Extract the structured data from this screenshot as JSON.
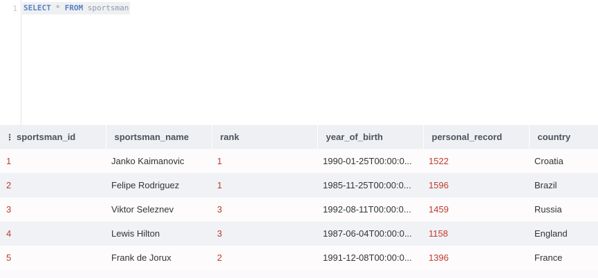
{
  "editor": {
    "line_number": "1",
    "tokens": {
      "select": "SELECT",
      "star": "*",
      "from": "FROM",
      "table": "sportsman"
    }
  },
  "result": {
    "columns": [
      "sportsman_id",
      "sportsman_name",
      "rank",
      "year_of_birth",
      "personal_record",
      "country"
    ],
    "rows": [
      {
        "sportsman_id": "1",
        "sportsman_name": "Janko Kaimanovic",
        "rank": "1",
        "year_of_birth": "1990-01-25T00:00:0...",
        "personal_record": "1522",
        "country": "Croatia"
      },
      {
        "sportsman_id": "2",
        "sportsman_name": "Felipe Rodriguez",
        "rank": "1",
        "year_of_birth": "1985-11-25T00:00:0...",
        "personal_record": "1596",
        "country": "Brazil"
      },
      {
        "sportsman_id": "3",
        "sportsman_name": "Viktor Seleznev",
        "rank": "3",
        "year_of_birth": "1992-08-11T00:00:0...",
        "personal_record": "1459",
        "country": "Russia"
      },
      {
        "sportsman_id": "4",
        "sportsman_name": "Lewis Hilton",
        "rank": "3",
        "year_of_birth": "1987-06-04T00:00:0...",
        "personal_record": "1158",
        "country": "England"
      },
      {
        "sportsman_id": "5",
        "sportsman_name": "Frank de Jorux",
        "rank": "2",
        "year_of_birth": "1991-12-08T00:00:0...",
        "personal_record": "1396",
        "country": "France"
      }
    ]
  },
  "colors": {
    "keyword": "#5b7fc4",
    "number": "#c0392b",
    "header_bg": "#eef0f3",
    "row_alt_bg": "#f0f2f5"
  },
  "icons": {
    "row_menu": "vertical-dots-icon"
  }
}
